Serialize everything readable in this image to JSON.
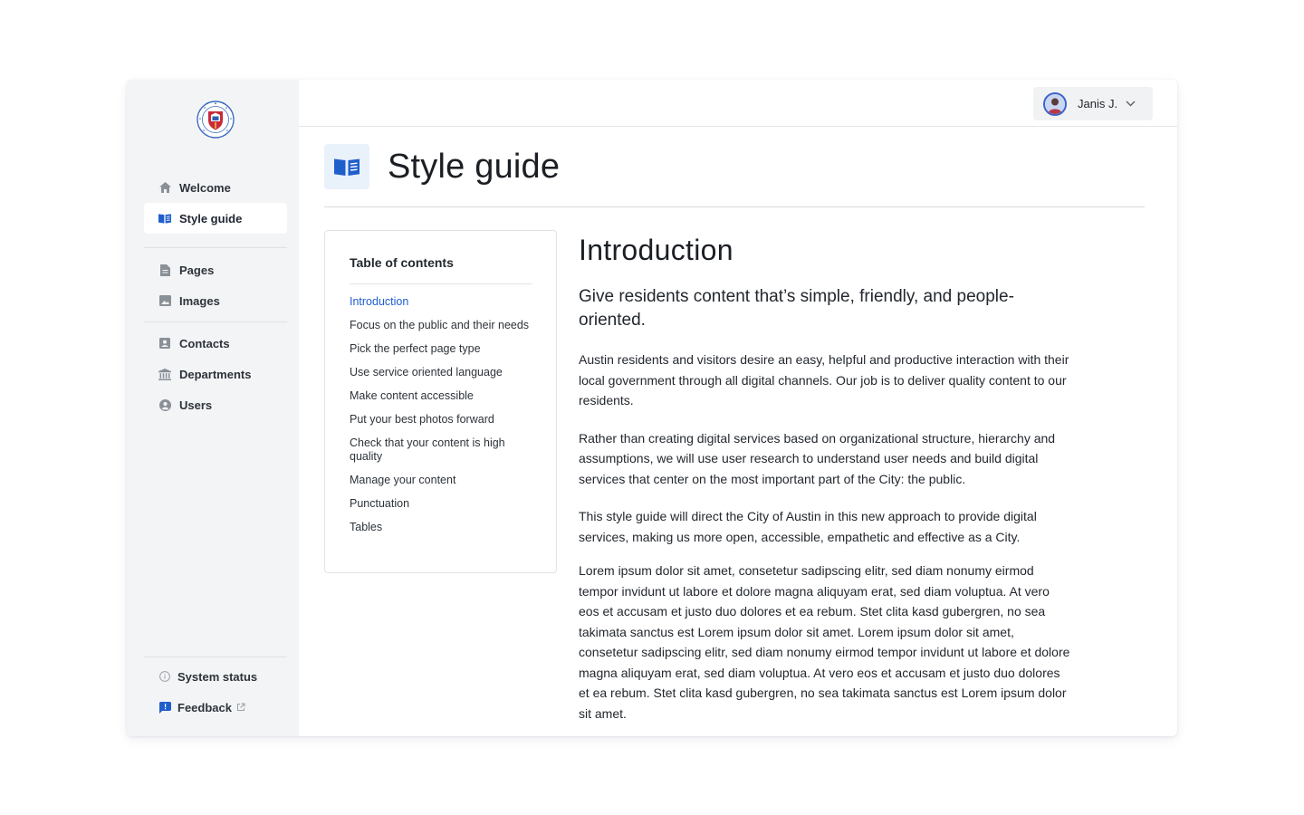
{
  "sidebar": {
    "logo_name": "City of Austin seal",
    "logo_text": "CITY OF AUSTIN · FOUNDED 1839",
    "primary": [
      {
        "label": "Welcome",
        "icon": "home-icon"
      },
      {
        "label": "Style guide",
        "icon": "book-icon",
        "active": true
      }
    ],
    "content_items": [
      {
        "label": "Pages",
        "icon": "document-icon"
      },
      {
        "label": "Images",
        "icon": "image-icon"
      }
    ],
    "admin_items": [
      {
        "label": "Contacts",
        "icon": "contact-card-icon"
      },
      {
        "label": "Departments",
        "icon": "building-icon"
      },
      {
        "label": "Users",
        "icon": "user-circle-icon"
      }
    ],
    "footer_items": [
      {
        "label": "System status",
        "icon": "info-icon"
      },
      {
        "label": "Feedback",
        "icon": "feedback-icon",
        "external": true
      }
    ]
  },
  "user": {
    "name": "Janis J."
  },
  "page": {
    "title": "Style guide"
  },
  "toc": {
    "title": "Table of contents",
    "items": [
      "Introduction",
      "Focus on the public and their needs",
      "Pick the perfect page type",
      "Use service oriented language",
      "Make content accessible",
      "Put your best photos forward",
      "Check that your content is high quality",
      "Manage your content",
      "Punctuation",
      "Tables"
    ],
    "current_index": 0
  },
  "article": {
    "heading": "Introduction",
    "lede": "Give residents content that’s simple, friendly, and people-oriented.",
    "paragraphs": [
      "Austin residents and visitors desire an easy, helpful and productive interaction with their local government through all digital channels. Our job is to deliver quality content to our residents.",
      "Rather than creating digital services based on organizational structure, hierarchy and assumptions, we will use user research to understand user needs and build digital services that center on the most important part of the City: the public.",
      "This style guide will direct the City of Austin in this new approach to provide digital services, making us more open, accessible, empathetic and effective as a City.",
      "Lorem ipsum dolor sit amet, consetetur sadipscing elitr, sed diam nonumy eirmod tempor invidunt ut labore et dolore magna aliquyam erat, sed diam voluptua. At vero eos et accusam et justo duo dolores et ea rebum. Stet clita kasd gubergren, no sea takimata sanctus est Lorem ipsum dolor sit amet. Lorem ipsum dolor sit amet, consetetur sadipscing elitr, sed diam nonumy eirmod tempor invidunt ut labore et dolore magna aliquyam erat, sed diam voluptua. At vero eos et accusam et justo duo dolores et ea rebum. Stet clita kasd gubergren, no sea takimata sanctus est Lorem ipsum dolor sit amet."
    ]
  },
  "colors": {
    "accent": "#1f5fcc",
    "sidebar_bg": "#f3f4f6",
    "header_icon_bg": "#e9f1fb"
  }
}
